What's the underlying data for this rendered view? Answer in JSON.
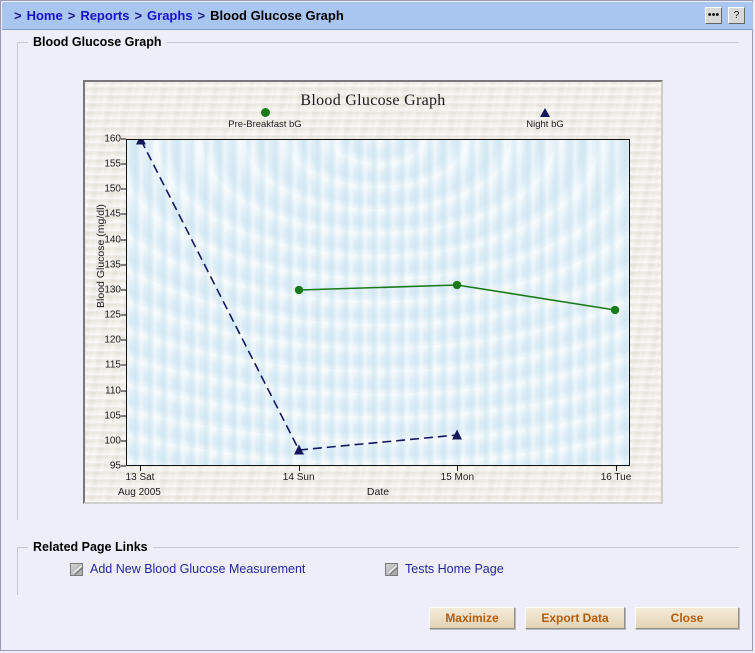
{
  "window": {
    "title": "Blood Glucose Graph"
  },
  "breadcrumb": {
    "separator": ">",
    "items": [
      {
        "label": "Home",
        "current": false
      },
      {
        "label": "Reports",
        "current": false
      },
      {
        "label": "Graphs",
        "current": false
      },
      {
        "label": "Blood Glucose Graph",
        "current": true
      }
    ],
    "tools": [
      {
        "name": "more-options-button",
        "glyph": "•••"
      },
      {
        "name": "help-button",
        "glyph": "?"
      }
    ]
  },
  "graph_panel": {
    "legend_title": "Blood Glucose Graph"
  },
  "links_panel": {
    "legend_title": "Related Page Links",
    "links": [
      {
        "label": "Add New Blood Glucose Measurement"
      },
      {
        "label": "Tests Home Page"
      }
    ]
  },
  "buttons": [
    {
      "label": "Maximize"
    },
    {
      "label": "Export Data"
    },
    {
      "label": "Close"
    }
  ],
  "colors": {
    "breadcrumb_bar": "#a8c6f0",
    "link": "#1414c8",
    "related_link": "#25259b",
    "button_text": "#b35c0a",
    "page_background": "#eeeefa",
    "plot_background": "#dfeef7",
    "chart_background": "#f1efe9",
    "series_pre_breakfast": "#1a7a1a",
    "series_night": "#14175e"
  },
  "chart_data": {
    "type": "line",
    "title": "Blood Glucose Graph",
    "xlabel": "Date",
    "ylabel": "Blood Glucose (mg/dl)",
    "x_subcaption": "Aug 2005",
    "categories": [
      "13 Sat",
      "14 Sun",
      "15 Mon",
      "16 Tue"
    ],
    "ylim": [
      95,
      160
    ],
    "yticks": [
      95,
      100,
      105,
      110,
      115,
      120,
      125,
      130,
      135,
      140,
      145,
      150,
      155,
      160
    ],
    "grid": false,
    "legend_position": "top",
    "series": [
      {
        "name": "Pre-Breakfast bG",
        "color": "#1a7a1a",
        "marker": "circle",
        "line_style": "solid",
        "values": [
          null,
          130,
          131,
          126
        ]
      },
      {
        "name": "Night bG",
        "color": "#14175e",
        "marker": "triangle",
        "line_style": "dashed",
        "values": [
          160,
          98,
          101,
          null
        ]
      }
    ]
  }
}
